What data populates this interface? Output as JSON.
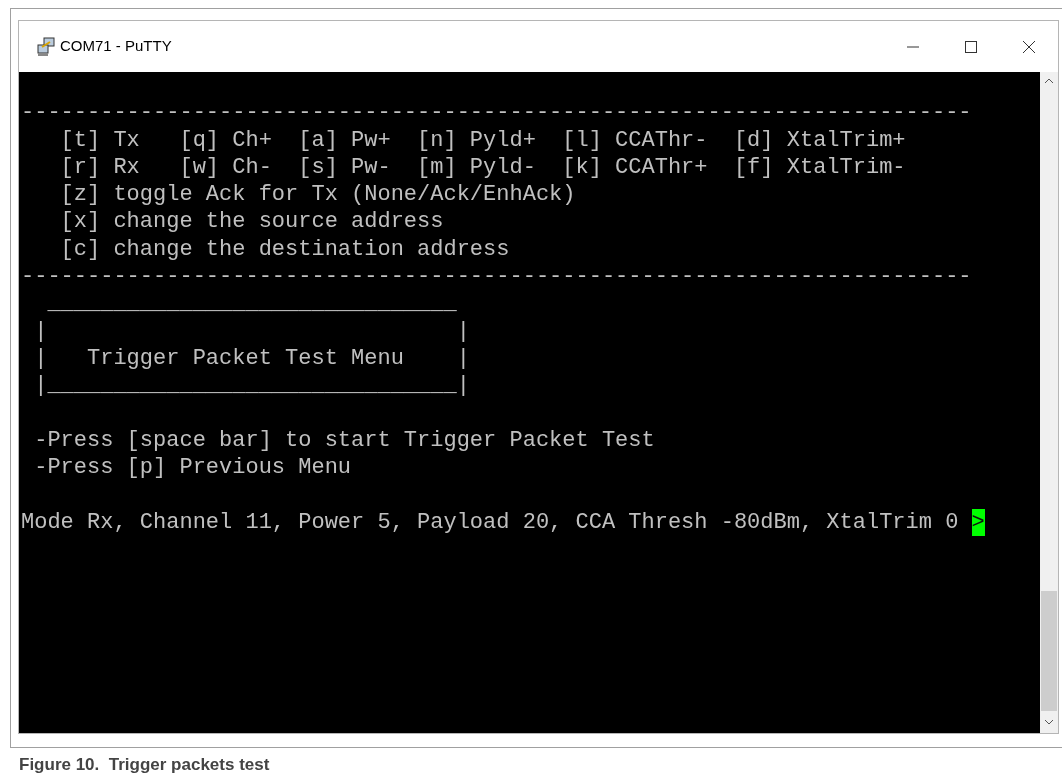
{
  "window": {
    "title": "COM71 - PuTTY"
  },
  "terminal": {
    "menu_lines": [
      "------------------------------------------------------------------------",
      "   [t] Tx   [q] Ch+  [a] Pw+  [n] Pyld+  [l] CCAThr-  [d] XtalTrim+",
      "   [r] Rx   [w] Ch-  [s] Pw-  [m] Pyld-  [k] CCAThr+  [f] XtalTrim-",
      "   [z] toggle Ack for Tx (None/Ack/EnhAck)",
      "   [x] change the source address",
      "   [c] change the destination address",
      "------------------------------------------------------------------------"
    ],
    "box_lines": [
      "  _______________________________",
      " |                               |",
      " |   Trigger Packet Test Menu    |",
      " |_______________________________|"
    ],
    "prompt_lines": [
      " -Press [space bar] to start Trigger Packet Test",
      " -Press [p] Previous Menu"
    ],
    "status_line": {
      "text": "Mode Rx, Channel 11, Power 5, Payload 20, CCA Thresh -80dBm, XtalTrim 0 ",
      "cursor": ">"
    }
  },
  "caption": "Figure 10.  Trigger packets test"
}
